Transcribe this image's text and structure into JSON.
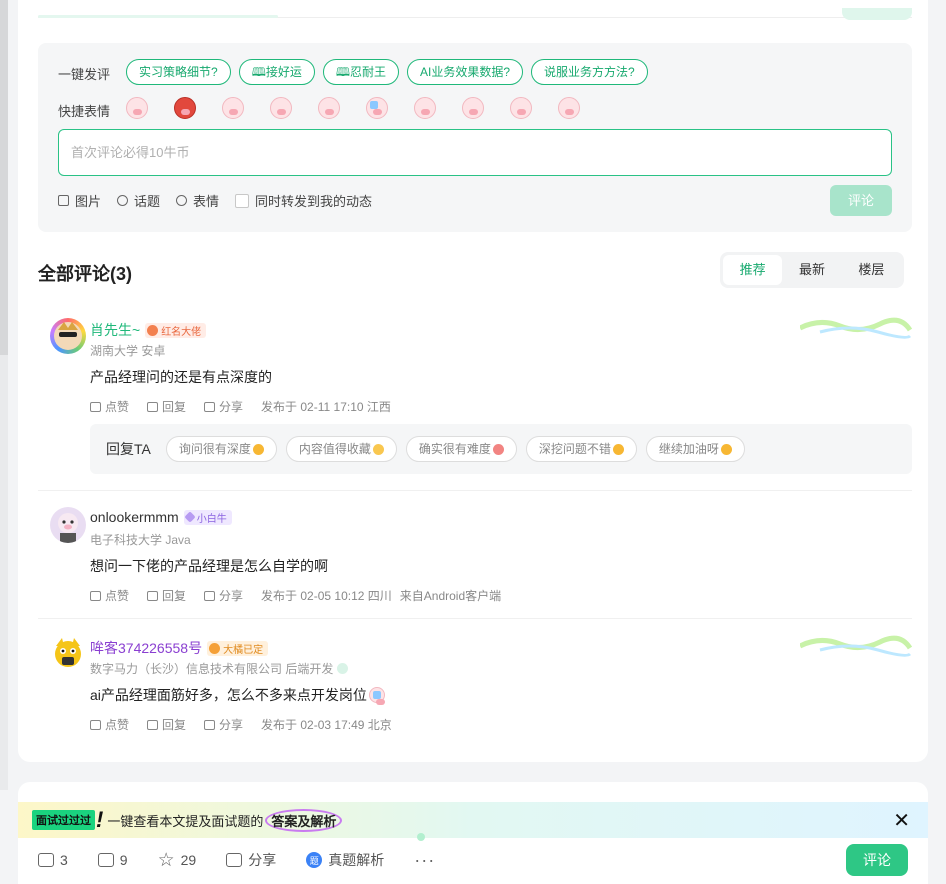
{
  "compose": {
    "quick_comment_label": "一键发评",
    "quick_comments": [
      "实习策略细节?",
      "🕮接好运",
      "🕮忍耐王",
      "AI业务效果数据?",
      "说服业务方方法?"
    ],
    "quick_emoji_label": "快捷表情",
    "emoji_count": 10,
    "input_placeholder": "首次评论必得10牛币",
    "tool_image": "图片",
    "tool_topic": "话题",
    "tool_emoji": "表情",
    "forward_label": "同时转发到我的动态",
    "submit_label": "评论"
  },
  "comments_header": {
    "title": "全部评论(3)",
    "sort_tabs": [
      "推荐",
      "最新",
      "楼层"
    ],
    "active_tab": "推荐"
  },
  "comments": [
    {
      "name": "肖先生~",
      "name_color": "#1fb87a",
      "badge": "红名大佬",
      "sub": "湖南大学 安卓",
      "text": "产品经理问的还是有点深度的",
      "like": "点赞",
      "reply": "回复",
      "share": "分享",
      "meta": "发布于 02-11 17:10 江西",
      "client": ""
    },
    {
      "name": "onlookermmm",
      "name_color": "#333333",
      "badge": "小白牛",
      "sub": "电子科技大学 Java",
      "text": "想问一下佬的产品经理是怎么自学的啊",
      "like": "点赞",
      "reply": "回复",
      "share": "分享",
      "meta": "发布于 02-05 10:12 四川",
      "client": "来自Android客户端"
    },
    {
      "name": "哞客374226558号",
      "name_color": "#8a3fd1",
      "badge": "大橘已定",
      "sub": "数字马力（长沙）信息技术有限公司 后端开发",
      "text": "ai产品经理面筋好多，怎么不多来点开发岗位",
      "like": "点赞",
      "reply": "回复",
      "share": "分享",
      "meta": "发布于 02-03 17:49 北京",
      "client": ""
    }
  ],
  "reply_ta": {
    "label": "回复TA",
    "chips": [
      "询问很有深度",
      "内容值得收藏",
      "确实很有难度",
      "深挖问题不错",
      "继续加油呀"
    ]
  },
  "banner": {
    "badge": "面试过过过",
    "text": "一键查看本文提及面试题的",
    "emphasis": "答案及解析"
  },
  "toolbar": {
    "comments": "3",
    "likes": "9",
    "stars": "29",
    "share": "分享",
    "analysis": "真题解析",
    "analysis_icon": "题",
    "more": "···",
    "comment_button": "评论"
  },
  "colors": {
    "accent": "#1fb87a",
    "button": "#2ec785"
  }
}
